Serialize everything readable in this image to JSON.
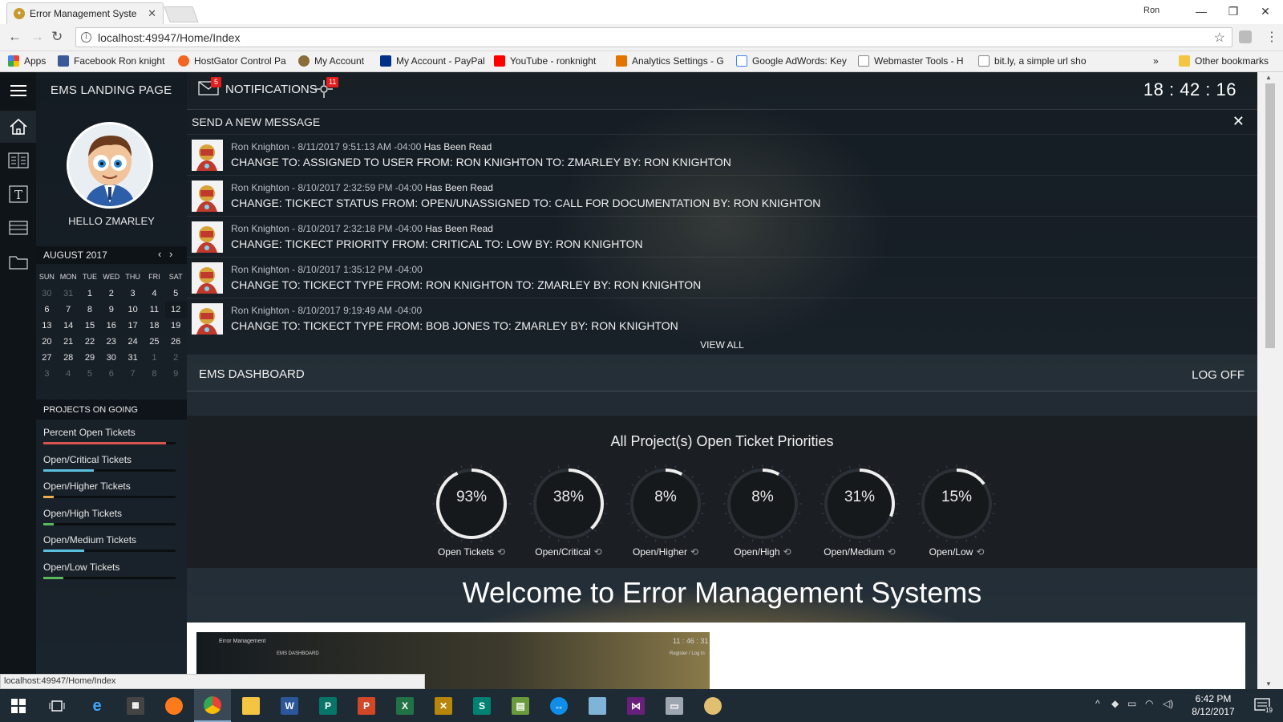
{
  "browser": {
    "tab_title": "Error Management Syste",
    "profile_name": "Ron",
    "url": "localhost:49947/Home/Index",
    "bookmarks": [
      {
        "label": "Apps",
        "color": "#4285f4"
      },
      {
        "label": "Facebook Ron knight",
        "color": "#3b5998"
      },
      {
        "label": "HostGator Control Pa",
        "color": "#f26522"
      },
      {
        "label": "My Account",
        "color": "#8a6d3b"
      },
      {
        "label": "My Account - PayPal",
        "color": "#003087"
      },
      {
        "label": "YouTube - ronknight",
        "color": "#ff0000"
      },
      {
        "label": "Analytics Settings - G",
        "color": "#e37400"
      },
      {
        "label": "Google AdWords: Key",
        "color": "#4285f4"
      },
      {
        "label": "Webmaster Tools - H",
        "color": "#9e9e9e"
      },
      {
        "label": "bit.ly, a simple url sho",
        "color": "#9e9e9e"
      }
    ],
    "overflow_label": "»",
    "other_bookmarks": "Other bookmarks",
    "status_url": "localhost:49947/Home/Index"
  },
  "sidebar": {
    "landing_title": "EMS LANDING PAGE",
    "greeting": "HELLO ZMARLEY",
    "calendar": {
      "month_label": "AUGUST 2017",
      "weekdays": [
        "SUN",
        "MON",
        "TUE",
        "WED",
        "THU",
        "FRI",
        "SAT"
      ],
      "weeks": [
        [
          {
            "d": "30",
            "o": true
          },
          {
            "d": "31",
            "o": true
          },
          {
            "d": "1"
          },
          {
            "d": "2"
          },
          {
            "d": "3"
          },
          {
            "d": "4"
          },
          {
            "d": "5"
          }
        ],
        [
          {
            "d": "6"
          },
          {
            "d": "7"
          },
          {
            "d": "8"
          },
          {
            "d": "9"
          },
          {
            "d": "10"
          },
          {
            "d": "11"
          },
          {
            "d": "12",
            "t": true
          }
        ],
        [
          {
            "d": "13"
          },
          {
            "d": "14"
          },
          {
            "d": "15"
          },
          {
            "d": "16"
          },
          {
            "d": "17"
          },
          {
            "d": "18"
          },
          {
            "d": "19"
          }
        ],
        [
          {
            "d": "20"
          },
          {
            "d": "21"
          },
          {
            "d": "22"
          },
          {
            "d": "23"
          },
          {
            "d": "24"
          },
          {
            "d": "25"
          },
          {
            "d": "26"
          }
        ],
        [
          {
            "d": "27"
          },
          {
            "d": "28"
          },
          {
            "d": "29"
          },
          {
            "d": "30"
          },
          {
            "d": "31"
          },
          {
            "d": "1",
            "o": true
          },
          {
            "d": "2",
            "o": true
          }
        ],
        [
          {
            "d": "3",
            "o": true
          },
          {
            "d": "4",
            "o": true
          },
          {
            "d": "5",
            "o": true
          },
          {
            "d": "6",
            "o": true
          },
          {
            "d": "7",
            "o": true
          },
          {
            "d": "8",
            "o": true
          },
          {
            "d": "9",
            "o": true
          }
        ]
      ]
    },
    "projects_title": "PROJECTS ON GOING",
    "projects": [
      {
        "label": "Percent Open Tickets",
        "fill": 0.93,
        "color": "#d9534f"
      },
      {
        "label": "Open/Critical Tickets",
        "fill": 0.38,
        "color": "#5bc0de"
      },
      {
        "label": "Open/Higher Tickets",
        "fill": 0.08,
        "color": "#f0ad4e"
      },
      {
        "label": "Open/High Tickets",
        "fill": 0.08,
        "color": "#5cb85c"
      },
      {
        "label": "Open/Medium Tickets",
        "fill": 0.31,
        "color": "#5bc0de"
      },
      {
        "label": "Open/Low Tickets",
        "fill": 0.15,
        "color": "#5cb85c"
      }
    ]
  },
  "header": {
    "notifications_label": "NOTIFICATIONS",
    "mail_badge": "5",
    "alerts_badge": "11",
    "clock": "18 : 42 : 16"
  },
  "messages": {
    "title": "SEND A NEW MESSAGE",
    "items": [
      {
        "meta": "Ron Knighton - 8/11/2017 9:51:13 AM -04:00",
        "status": "Has Been Read",
        "text": "CHANGE TO: ASSIGNED TO USER FROM: RON KNIGHTON TO: ZMARLEY BY: RON KNIGHTON"
      },
      {
        "meta": "Ron Knighton - 8/10/2017 2:32:59 PM -04:00",
        "status": "Has Been Read",
        "text": "CHANGE: TICKECT STATUS FROM: OPEN/UNASSIGNED TO: CALL FOR DOCUMENTATION BY: RON KNIGHTON"
      },
      {
        "meta": "Ron Knighton - 8/10/2017 2:32:18 PM -04:00",
        "status": "Has Been Read",
        "text": "CHANGE: TICKECT PRIORITY FROM: CRITICAL TO: LOW BY: RON KNIGHTON"
      },
      {
        "meta": "Ron Knighton - 8/10/2017 1:35:12 PM -04:00",
        "status": "",
        "text": "CHANGE TO: TICKECT TYPE FROM: RON KNIGHTON TO: ZMARLEY BY: RON KNIGHTON"
      },
      {
        "meta": "Ron Knighton - 8/10/2017 9:19:49 AM -04:00",
        "status": "",
        "text": "CHANGE TO: TICKECT TYPE FROM: BOB JONES TO: ZMARLEY BY: RON KNIGHTON"
      }
    ],
    "view_all": "VIEW ALL"
  },
  "dashboard": {
    "title": "EMS DASHBOARD",
    "logoff": "LOG OFF",
    "priorities_title": "All Project(s) Open Ticket Priorities",
    "gauges": [
      {
        "value": "93%",
        "fraction": 0.93,
        "label": "Open Tickets"
      },
      {
        "value": "38%",
        "fraction": 0.38,
        "label": "Open/Critical"
      },
      {
        "value": "8%",
        "fraction": 0.08,
        "label": "Open/Higher"
      },
      {
        "value": "8%",
        "fraction": 0.08,
        "label": "Open/High"
      },
      {
        "value": "31%",
        "fraction": 0.31,
        "label": "Open/Medium"
      },
      {
        "value": "15%",
        "fraction": 0.15,
        "label": "Open/Low"
      }
    ],
    "welcome": "Welcome to Error Management Systems",
    "preview": {
      "app_name": "Error Management",
      "clock": "11 : 46 : 31",
      "dash_label": "EMS DASHBOARD",
      "links": "Register  /  Log in"
    }
  },
  "taskbar": {
    "time": "6:42 PM",
    "date": "8/12/2017",
    "notif_count": "19"
  }
}
